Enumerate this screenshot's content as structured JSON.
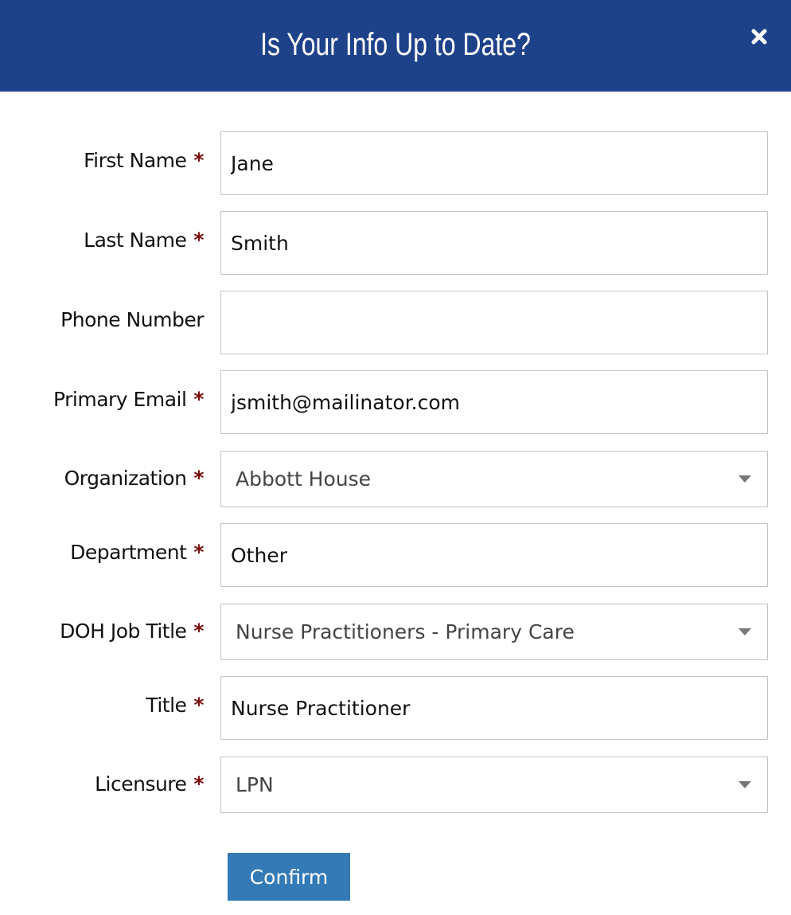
{
  "modal": {
    "title": "Is Your Info Up to Date?",
    "close_icon": "close-icon"
  },
  "form": {
    "required_marker": "*",
    "first_name": {
      "label": "First Name",
      "value": "Jane"
    },
    "last_name": {
      "label": "Last Name",
      "value": "Smith"
    },
    "phone_number": {
      "label": "Phone Number",
      "value": ""
    },
    "primary_email": {
      "label": "Primary Email",
      "value": "jsmith@mailinator.com"
    },
    "organization": {
      "label": "Organization",
      "selected": "Abbott House"
    },
    "department": {
      "label": "Department",
      "value": "Other"
    },
    "doh_job_title": {
      "label": "DOH Job Title",
      "selected": "Nurse Practitioners - Primary Care"
    },
    "title": {
      "label": "Title",
      "value": "Nurse Practitioner"
    },
    "licensure": {
      "label": "Licensure",
      "selected": "LPN"
    }
  },
  "actions": {
    "confirm_label": "Confirm"
  },
  "colors": {
    "header_bg": "#1e428a",
    "required_star": "#7a0a0a",
    "confirm_bg": "#337ab7"
  }
}
